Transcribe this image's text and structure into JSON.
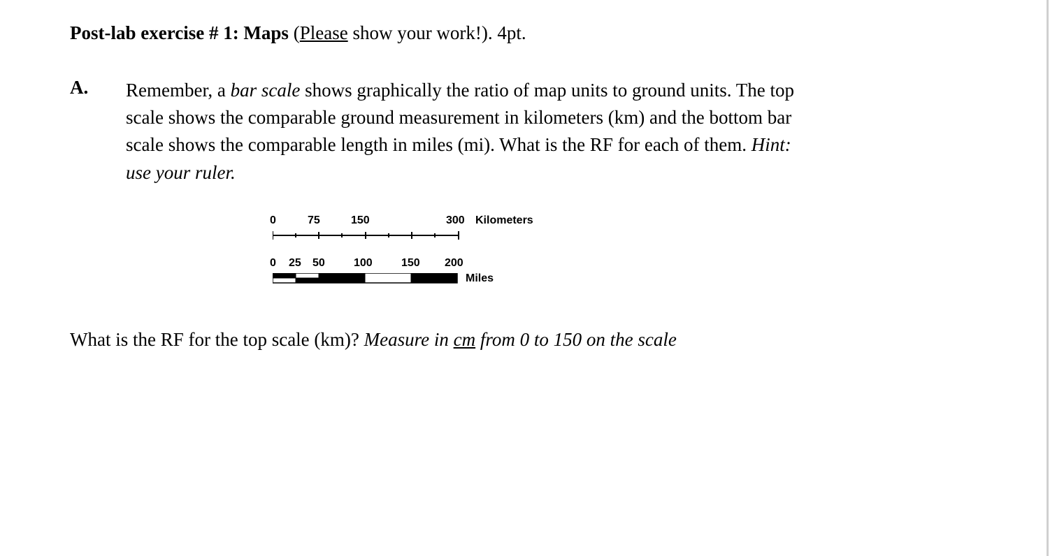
{
  "title": {
    "prefix": "Post-lab exercise # 1: Maps",
    "paren_text_underlined": "Please",
    "paren_text_rest": " show your work!).",
    "points": "4pt."
  },
  "section": {
    "label": "A.",
    "body_1": "Remember, a ",
    "body_italic_1": "bar scale",
    "body_2": " shows graphically the ratio of map units to ground units. The top scale shows the comparable ground measurement in kilometers (km) and the bottom bar scale shows the comparable length in miles (mi). What is the RF for each of them. ",
    "hint": "Hint: use your ruler."
  },
  "km_scale": {
    "labels": [
      "0",
      "75",
      "150",
      "300"
    ],
    "unit": "Kilometers",
    "ticks_major": [
      0,
      75,
      150,
      225,
      300
    ],
    "ticks_minor_step": 37.5,
    "pixel_per_km": 0.885
  },
  "mi_scale": {
    "labels": [
      "0",
      "25",
      "50",
      "100",
      "150",
      "200"
    ],
    "unit": "Miles",
    "segments": [
      {
        "start": 0,
        "end": 25,
        "style": "split"
      },
      {
        "start": 25,
        "end": 50,
        "style": "split"
      },
      {
        "start": 50,
        "end": 100,
        "style": "solid"
      },
      {
        "start": 100,
        "end": 150,
        "style": "hollow"
      },
      {
        "start": 150,
        "end": 200,
        "style": "solid"
      }
    ],
    "pixel_per_mi": 1.33
  },
  "question": {
    "prefix": "What is the RF for the top scale (km)? ",
    "italic_part_1": "Measure in ",
    "italic_underlined": "cm",
    "italic_part_2": " from 0 to 150 on the scale"
  }
}
